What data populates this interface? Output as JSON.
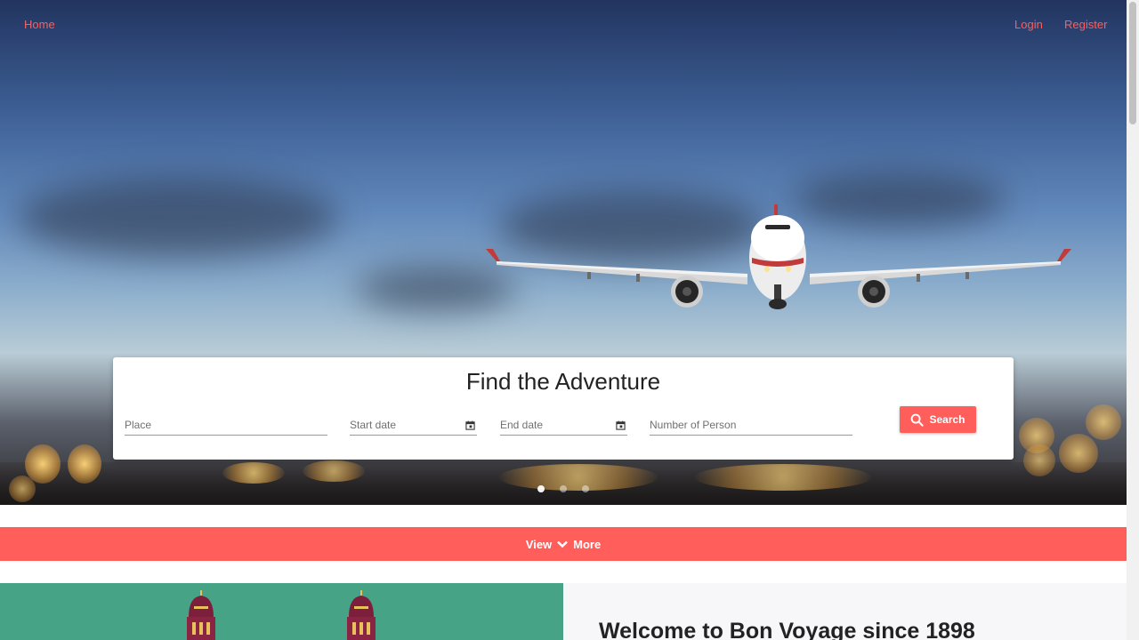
{
  "nav": {
    "home_label": "Home",
    "login_label": "Login",
    "register_label": "Register"
  },
  "hero": {
    "slide_count": 3,
    "active_slide": 1
  },
  "search": {
    "title": "Find the Adventure",
    "place_placeholder": "Place",
    "start_date_placeholder": "Start date",
    "end_date_placeholder": "End date",
    "persons_placeholder": "Number of Person",
    "button_label": "Search"
  },
  "view_more": {
    "left_label": "View",
    "right_label": "More"
  },
  "welcome": {
    "title": "Welcome to Bon Voyage since 1898"
  },
  "colors": {
    "accent": "#ff5e5b",
    "image_panel": "#47a385",
    "welcome_bg": "#f7f7f9"
  },
  "icons": [
    "calendar-icon",
    "search-icon",
    "chevron-down-icon"
  ]
}
